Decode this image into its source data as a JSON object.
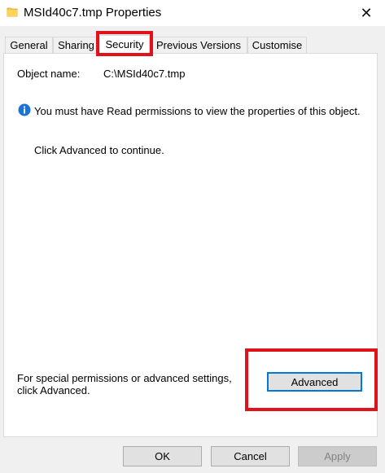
{
  "window": {
    "title": "MSId40c7.tmp Properties",
    "icon": "folder-icon",
    "close_glyph": "✕"
  },
  "tabs": [
    {
      "label": "General"
    },
    {
      "label": "Sharing"
    },
    {
      "label": "Security",
      "active": true
    },
    {
      "label": "Previous Versions"
    },
    {
      "label": "Customise"
    }
  ],
  "security": {
    "object_name_label": "Object name:",
    "object_name_value": "C:\\MSId40c7.tmp",
    "info_icon": "info-icon",
    "info_message": "You must have Read permissions to view the properties of this object.",
    "continue_message": "Click Advanced to continue.",
    "special_message": "For special permissions or advanced settings, click Advanced.",
    "advanced_label": "Advanced"
  },
  "footer": {
    "ok_label": "OK",
    "cancel_label": "Cancel",
    "apply_label": "Apply"
  },
  "colors": {
    "highlight": "#e0131a",
    "accent": "#0078d7",
    "info_blue": "#1a73d9"
  }
}
